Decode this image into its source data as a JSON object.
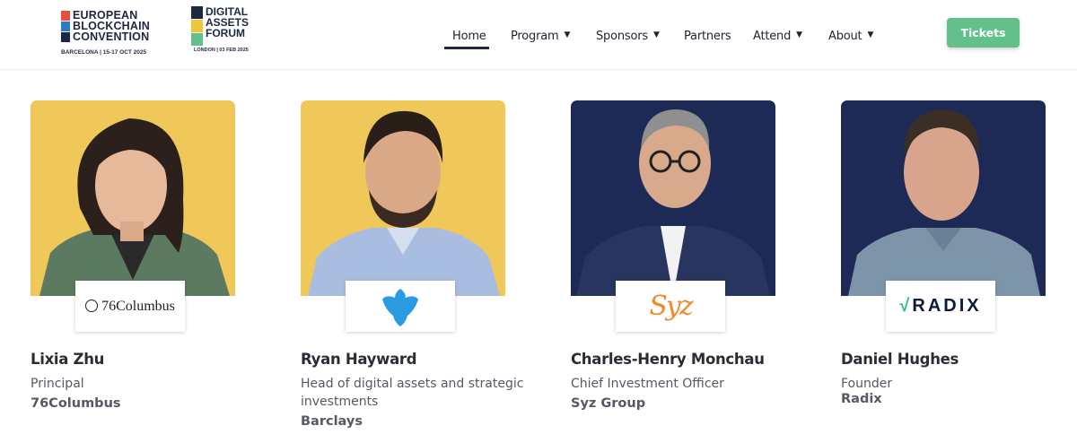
{
  "header": {
    "ebc_logo": {
      "lines": [
        "EUROPEAN",
        "BLOCKCHAIN",
        "CONVENTION"
      ],
      "sub": "BARCELONA | 15-17 OCT 2025",
      "colors": [
        "#e94e3c",
        "#2f7bbf",
        "#1f2740",
        "#1f2740"
      ]
    },
    "daf_logo": {
      "lines": [
        "DIGITAL",
        "ASSETS",
        "FORUM"
      ],
      "sub": "LONDON | 03 FEB 2025",
      "colors": [
        "#1f2740",
        "#f0c53c",
        "#63c08a"
      ]
    },
    "nav": [
      {
        "label": "Home",
        "has_dropdown": false,
        "active": true
      },
      {
        "label": "Program",
        "has_dropdown": true
      },
      {
        "label": "Sponsors",
        "has_dropdown": true
      },
      {
        "label": "Partners",
        "has_dropdown": false
      },
      {
        "label": "Attend",
        "has_dropdown": true
      },
      {
        "label": "About",
        "has_dropdown": true
      }
    ],
    "dropdown_icon": "chevron-down-icon",
    "tickets_label": "Tickets",
    "tickets_color": "#63c08a"
  },
  "speakers": [
    {
      "name": "Lixia Zhu",
      "role": "Principal",
      "company": "76Columbus",
      "company_logo_text": "76Columbus",
      "bg_color": "#f0c85a"
    },
    {
      "name": "Ryan Hayward",
      "role": "Head of digital assets and strategic investments",
      "company": "Barclays",
      "company_logo_icon": "eagle-icon",
      "bg_color": "#f0c85a"
    },
    {
      "name": "Charles-Henry Monchau",
      "role": "Chief Investment Officer",
      "company": "Syz Group",
      "company_logo_text": "Syz",
      "bg_color": "#1d2a56"
    },
    {
      "name": "Daniel Hughes",
      "role": "Founder",
      "company": "Radix",
      "company_logo_text": "RADIX",
      "bg_color": "#1d2a56"
    }
  ]
}
